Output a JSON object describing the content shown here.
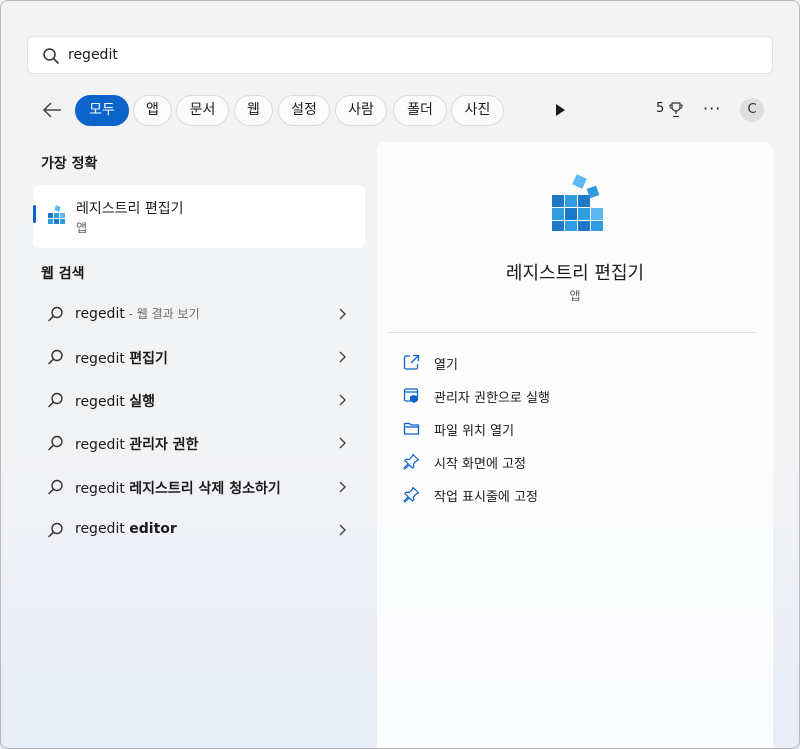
{
  "search": {
    "query": "regedit"
  },
  "filters": {
    "chips": [
      "모두",
      "앱",
      "문서",
      "웹",
      "설정",
      "사람",
      "폴더",
      "사진"
    ],
    "points": "5",
    "avatar_initial": "C"
  },
  "best_match": {
    "section_title": "가장 정확",
    "title": "레지스트리 편집기",
    "subtitle": "앱"
  },
  "web_search": {
    "section_title": "웹 검색",
    "items": [
      {
        "query": "regedit",
        "suffix": "",
        "hint": " - 웹 결과 보기"
      },
      {
        "query": "regedit ",
        "suffix": "편집기",
        "hint": ""
      },
      {
        "query": "regedit ",
        "suffix": "실행",
        "hint": ""
      },
      {
        "query": "regedit ",
        "suffix": "관리자 권한",
        "hint": ""
      },
      {
        "query": "regedit ",
        "suffix": "레지스트리 삭제 청소하기",
        "hint": ""
      },
      {
        "query": "regedit ",
        "suffix": "editor",
        "hint": ""
      }
    ]
  },
  "details": {
    "name": "레지스트리 편집기",
    "type": "앱",
    "actions": [
      {
        "label": "열기",
        "icon": "open-external-icon"
      },
      {
        "label": "관리자 권한으로 실행",
        "icon": "shield-run-icon"
      },
      {
        "label": "파일 위치 열기",
        "icon": "folder-open-icon"
      },
      {
        "label": "시작 화면에 고정",
        "icon": "pin-icon"
      },
      {
        "label": "작업 표시줄에 고정",
        "icon": "pin-icon"
      }
    ]
  },
  "colors": {
    "accent": "#0a64c9",
    "icon_blue": "#2f9ce0"
  }
}
